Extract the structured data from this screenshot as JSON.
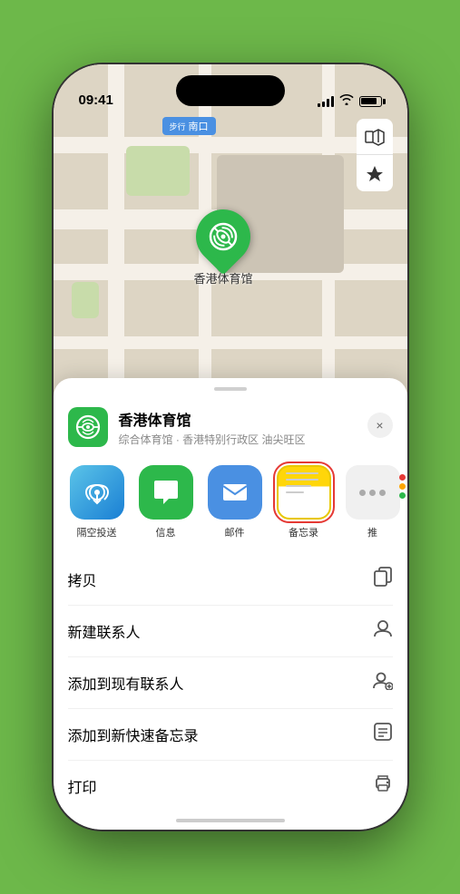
{
  "status_bar": {
    "time": "09:41",
    "signal_label": "signal",
    "wifi_label": "wifi",
    "battery_label": "battery"
  },
  "map": {
    "location_badge": "南口",
    "location_badge_prefix": "步行",
    "controls": {
      "map_type_icon": "🗺",
      "location_icon": "⬆"
    }
  },
  "marker": {
    "label": "香港体育馆"
  },
  "venue": {
    "name": "香港体育馆",
    "subtitle": "综合体育馆 · 香港特别行政区 油尖旺区",
    "close_label": "×"
  },
  "share_items": [
    {
      "id": "airdrop",
      "label": "隔空投送",
      "bg": "airdrop"
    },
    {
      "id": "messages",
      "label": "信息",
      "bg": "messages"
    },
    {
      "id": "mail",
      "label": "邮件",
      "bg": "mail"
    },
    {
      "id": "notes",
      "label": "备忘录",
      "bg": "notes"
    },
    {
      "id": "more",
      "label": "推",
      "bg": "more"
    }
  ],
  "actions": [
    {
      "id": "copy",
      "label": "拷贝",
      "icon": "⎘"
    },
    {
      "id": "new-contact",
      "label": "新建联系人",
      "icon": "👤"
    },
    {
      "id": "add-existing",
      "label": "添加到现有联系人",
      "icon": "👤+"
    },
    {
      "id": "add-notes",
      "label": "添加到新快速备忘录",
      "icon": "📋"
    },
    {
      "id": "print",
      "label": "打印",
      "icon": "🖨"
    }
  ]
}
